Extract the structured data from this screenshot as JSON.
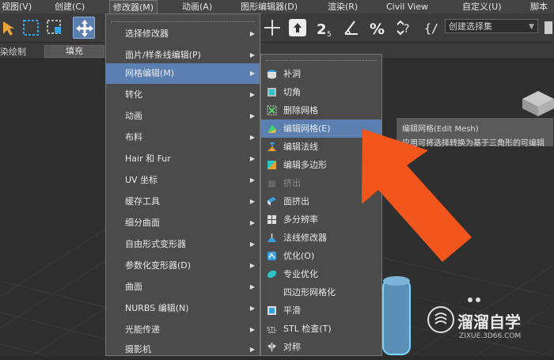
{
  "menubar": {
    "items": [
      "视图(V)",
      "创建(C)",
      "修改器(M)",
      "动画(A)",
      "图形编辑器(D)",
      "渲染(R)",
      "Civil View",
      "自定义(U)",
      "脚本"
    ]
  },
  "toolbar": {
    "selection_set_placeholder": "创建选择集",
    "icons": [
      "select-icon",
      "rect-select-icon",
      "window-crossing-icon",
      "move-icon",
      "snap-icon",
      "percent-snap-icon",
      "spinner-snap-icon",
      "edit-named-sets-icon"
    ]
  },
  "ribbon": {
    "label": "染绘制",
    "fill_button": "填充"
  },
  "modifiers_menu": {
    "items": [
      {
        "label": "选择修改器",
        "has_sub": true
      },
      {
        "label": "面片/样条线编辑(P)",
        "has_sub": true
      },
      {
        "label": "网格编辑(M)",
        "has_sub": true,
        "highlighted": true
      },
      {
        "label": "转化",
        "has_sub": true
      },
      {
        "label": "动画",
        "has_sub": true
      },
      {
        "label": "布料",
        "has_sub": true
      },
      {
        "label": "Hair 和 Fur",
        "has_sub": true
      },
      {
        "label": "UV 坐标",
        "has_sub": true
      },
      {
        "label": "缓存工具",
        "has_sub": true
      },
      {
        "label": "细分曲面",
        "has_sub": true
      },
      {
        "label": "自由形式变形器",
        "has_sub": true
      },
      {
        "label": "参数化变形器(D)",
        "has_sub": true
      },
      {
        "label": "曲面",
        "has_sub": true
      },
      {
        "label": "NURBS 编辑(N)",
        "has_sub": true
      },
      {
        "label": "光能传递",
        "has_sub": true
      },
      {
        "label": "摄影机",
        "has_sub": true
      }
    ]
  },
  "mesh_edit_submenu": {
    "items": [
      {
        "label": "补洞",
        "icon": "cap-holes-icon"
      },
      {
        "label": "切角",
        "icon": "chamfer-icon"
      },
      {
        "label": "删除网格",
        "icon": "delete-mesh-icon"
      },
      {
        "label": "编辑网格(E)",
        "icon": "edit-mesh-icon",
        "highlighted": true
      },
      {
        "label": "编辑法线",
        "icon": "edit-normals-icon"
      },
      {
        "label": "编辑多边形",
        "icon": "edit-poly-icon"
      },
      {
        "label": "挤出",
        "icon": "extrude-icon",
        "disabled": true
      },
      {
        "label": "面挤出",
        "icon": "face-extrude-icon"
      },
      {
        "label": "多分辨率",
        "icon": "multires-icon"
      },
      {
        "label": "法线修改器",
        "icon": "normal-modifier-icon"
      },
      {
        "label": "优化(O)",
        "icon": "optimize-icon"
      },
      {
        "label": "专业优化",
        "icon": "pro-optimizer-icon"
      },
      {
        "label": "四边形网格化",
        "icon": ""
      },
      {
        "label": "平滑",
        "icon": "smooth-icon"
      },
      {
        "label": "STL 检查(T)",
        "icon": "stl-check-icon"
      },
      {
        "label": "对称",
        "icon": "symmetry-icon"
      }
    ]
  },
  "tooltip": {
    "title": "编辑网格(Edit Mesh)",
    "description": "应用可将选择转换为基于三角形的可编辑"
  },
  "watermark": {
    "name": "溜溜自学",
    "url": "ZIXUE.3D66.COM"
  },
  "colors": {
    "highlight": "#5b7fb0",
    "arrow": "#f2561d",
    "menu_bg": "#4b4b4b"
  }
}
